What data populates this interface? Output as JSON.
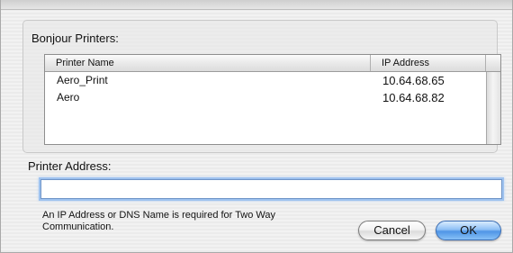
{
  "bonjour_section": {
    "label": "Bonjour Printers:"
  },
  "printer_table": {
    "columns": [
      "Printer Name",
      "IP Address"
    ],
    "rows": [
      {
        "name": "Aero_Print",
        "ip": "10.64.68.65"
      },
      {
        "name": "Aero",
        "ip": "10.64.68.82"
      }
    ]
  },
  "address_section": {
    "label": "Printer Address:",
    "value": "",
    "placeholder": ""
  },
  "note": {
    "text": "An IP Address or DNS Name is required for Two Way Communication."
  },
  "buttons": {
    "cancel_label": "Cancel",
    "ok_label": "OK"
  },
  "colors": {
    "default_button": "#4f95e6",
    "focus_ring": "#9ec2ef"
  }
}
